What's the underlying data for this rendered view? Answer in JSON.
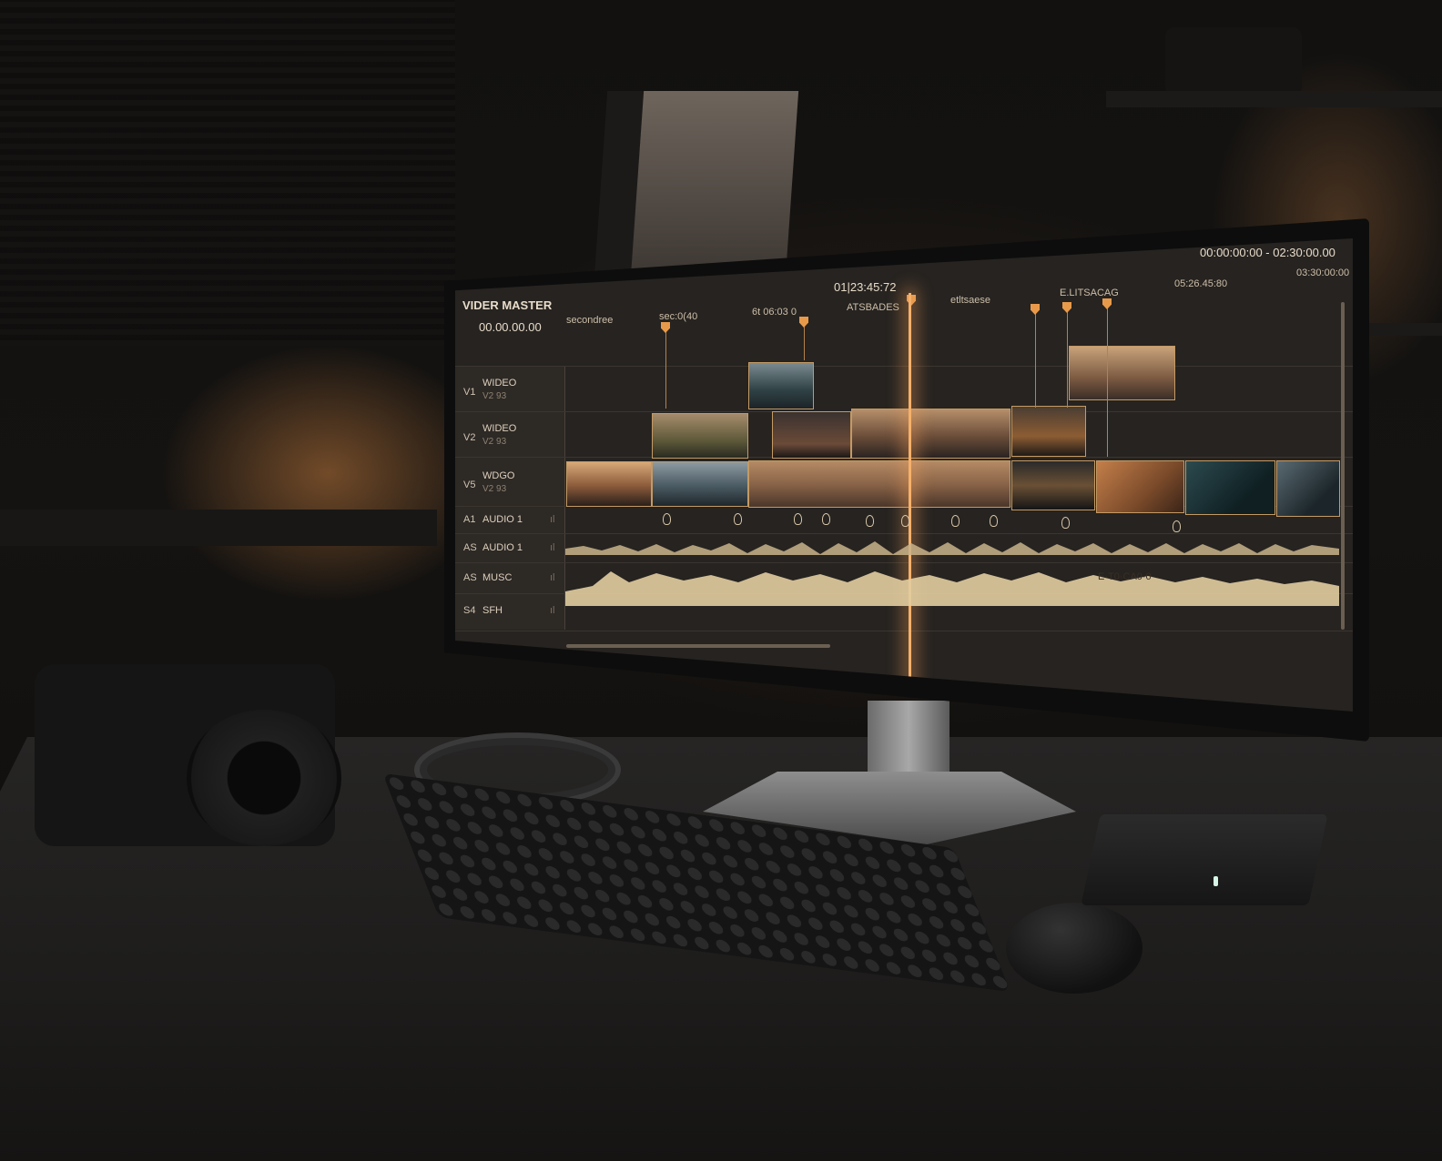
{
  "timeline": {
    "title": "VIDER MASTER",
    "left_timecode": "00.00.00.00",
    "center_timecode": "01|23:45:72",
    "range_timecode": "00:00:00:00 - 02:30:00.00",
    "right_timecode": "03:30:00:00",
    "ruler_labels": [
      "secondree",
      "sec:0(40",
      "6t 06:03 0",
      "ATSBADES",
      "etltsaese",
      "E.LITSACAG",
      "05:26.45:80"
    ],
    "tracks": [
      {
        "id": "V1",
        "name": "WIDEO",
        "sub": "V2 93"
      },
      {
        "id": "V2",
        "name": "WIDEO",
        "sub": "V2 93"
      },
      {
        "id": "V5",
        "name": "WDGO",
        "sub": "V2 93"
      },
      {
        "id": "A1",
        "name": "AUDIO 1",
        "sub": ""
      },
      {
        "id": "AS",
        "name": "AUDIO 1",
        "sub": ""
      },
      {
        "id": "AS",
        "name": "MUSC",
        "sub": ""
      },
      {
        "id": "S4",
        "name": "SFH",
        "sub": ""
      }
    ],
    "meter_glyph": "ıl",
    "waveform_label": "E·T0·CA0·0",
    "colors": {
      "accent": "#e89a4a",
      "playhead": "#f5b06a",
      "panel": "#262320"
    }
  }
}
